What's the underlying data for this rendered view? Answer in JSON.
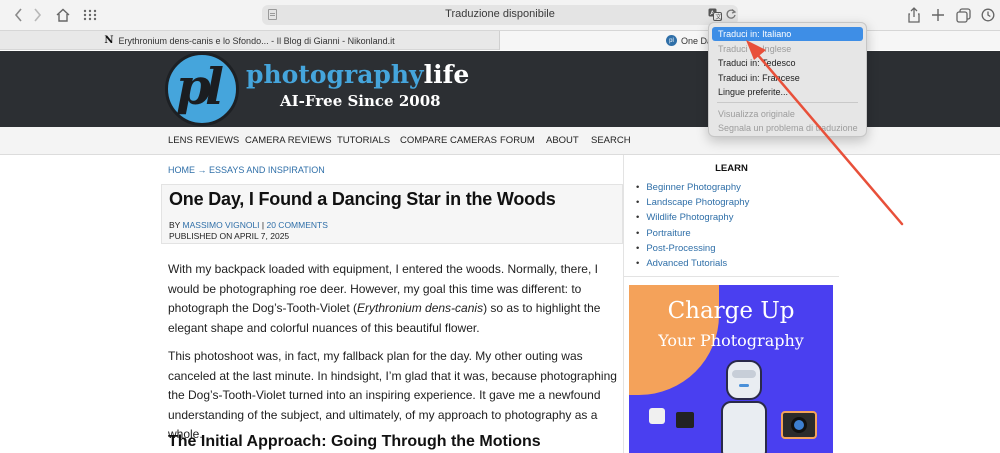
{
  "browser": {
    "address_text": "Traduzione disponibile",
    "tabs": [
      {
        "favicon": "N",
        "title": "Erythronium dens-canis e lo Sfondo... - Il Blog di Gianni - Nikonland.it"
      },
      {
        "favicon": "pl",
        "title": "One Day"
      }
    ]
  },
  "translate_menu": {
    "items": [
      {
        "label": "Traduci in: Italiano",
        "state": "selected"
      },
      {
        "label": "Traduci in: Inglese",
        "state": "disabled"
      },
      {
        "label": "Traduci in: Tedesco",
        "state": "normal"
      },
      {
        "label": "Traduci in: Francese",
        "state": "normal"
      },
      {
        "label": "Lingue preferite...",
        "state": "normal"
      },
      {
        "label": "Visualizza originale",
        "state": "disabled"
      },
      {
        "label": "Segnala un problema di traduzione",
        "state": "disabled"
      }
    ]
  },
  "site": {
    "logo_letters": "pl",
    "logo_word_a": "photography",
    "logo_word_b": "life",
    "tagline": "AI-Free Since 2008",
    "nav": [
      "LENS REVIEWS",
      "CAMERA REVIEWS",
      "TUTORIALS",
      "COMPARE CAMERAS",
      "FORUM",
      "ABOUT",
      "SEARCH"
    ]
  },
  "article": {
    "breadcrumb": "HOME → ESSAYS AND INSPIRATION",
    "title": "One Day, I Found a Dancing Star in the Woods",
    "by_prefix": "BY ",
    "author": "MASSIMO VIGNOLI",
    "separator": " | ",
    "comments": "20 COMMENTS",
    "published": "PUBLISHED ON APRIL 7, 2025",
    "p1_a": "With my backpack loaded with equipment, I entered the woods. Normally, there, I would be photographing roe deer. However, my goal this time was different: to photograph the Dog’s-Tooth-Violet (",
    "p1_em": "Erythronium dens-canis",
    "p1_b": ") so as to highlight the elegant shape and colorful nuances of this beautiful flower.",
    "p2": "This photoshoot was, in fact, my fallback plan for the day. My other outing was canceled at the last minute. In hindsight, I’m glad that it was, because photographing the Dog’s-Tooth-Violet turned into an inspiring experience. It gave me a newfound understanding of the subject, and ultimately, of my approach to photography as a whole.",
    "subheading": "The Initial Approach: Going Through the Motions"
  },
  "sidebar": {
    "learn_title": "LEARN",
    "learn_items": [
      "Beginner Photography",
      "Landscape Photography",
      "Wildlife Photography",
      "Portraiture",
      "Post-Processing",
      "Advanced Tutorials"
    ],
    "ad_line1": "Charge Up",
    "ad_line2": "Your Photography"
  },
  "colors": {
    "accent_link": "#2f6fa8",
    "logo_blue": "#45a5dc",
    "header_bg": "#2c2f33",
    "menu_selected": "#3e8ee6",
    "annotation_arrow": "#e8503a"
  }
}
